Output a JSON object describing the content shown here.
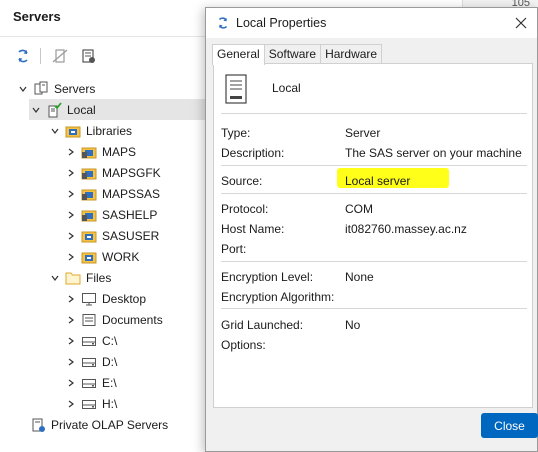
{
  "panel": {
    "title": "Servers",
    "top_right_text": "105"
  },
  "tree": {
    "root": "Servers",
    "local": "Local",
    "libraries": "Libraries",
    "libs": [
      "MAPS",
      "MAPSGFK",
      "MAPSSAS",
      "SASHELP",
      "SASUSER",
      "WORK"
    ],
    "files": "Files",
    "file_items": [
      "Desktop",
      "Documents",
      "C:\\",
      "D:\\",
      "E:\\",
      "H:\\"
    ],
    "olap": "Private OLAP Servers"
  },
  "dialog": {
    "title": "Local Properties",
    "tabs": [
      "General",
      "Software",
      "Hardware"
    ],
    "server_name": "Local",
    "fields": {
      "type_label": "Type:",
      "type_value": "Server",
      "description_label": "Description:",
      "description_value": "The SAS server on your machine",
      "source_label": "Source:",
      "source_value": "Local server",
      "protocol_label": "Protocol:",
      "protocol_value": "COM",
      "host_label": "Host Name:",
      "host_value": "it082760.massey.ac.nz",
      "port_label": "Port:",
      "port_value": "",
      "enc_level_label": "Encryption Level:",
      "enc_level_value": "None",
      "enc_algo_label": "Encryption Algorithm:",
      "enc_algo_value": "",
      "grid_label": "Grid Launched:",
      "grid_value": "No",
      "options_label": "Options:",
      "options_value": ""
    },
    "close_label": "Close"
  },
  "colors": {
    "highlight": "#ffff1a",
    "primary_button": "#0067c0",
    "selection": "#e5e5e5",
    "folder": "#f5c242",
    "library_blue": "#2f6fc1"
  },
  "icons": {
    "refresh": "refresh-icon",
    "disconnect": "disconnect-icon",
    "properties": "server-properties-icon",
    "chevron_down": "chevron-down-icon",
    "chevron_right": "chevron-right-icon",
    "server": "server-icon",
    "library": "library-icon",
    "folder": "folder-icon",
    "desktop": "desktop-icon",
    "drive": "drive-icon",
    "olap": "olap-server-icon"
  }
}
